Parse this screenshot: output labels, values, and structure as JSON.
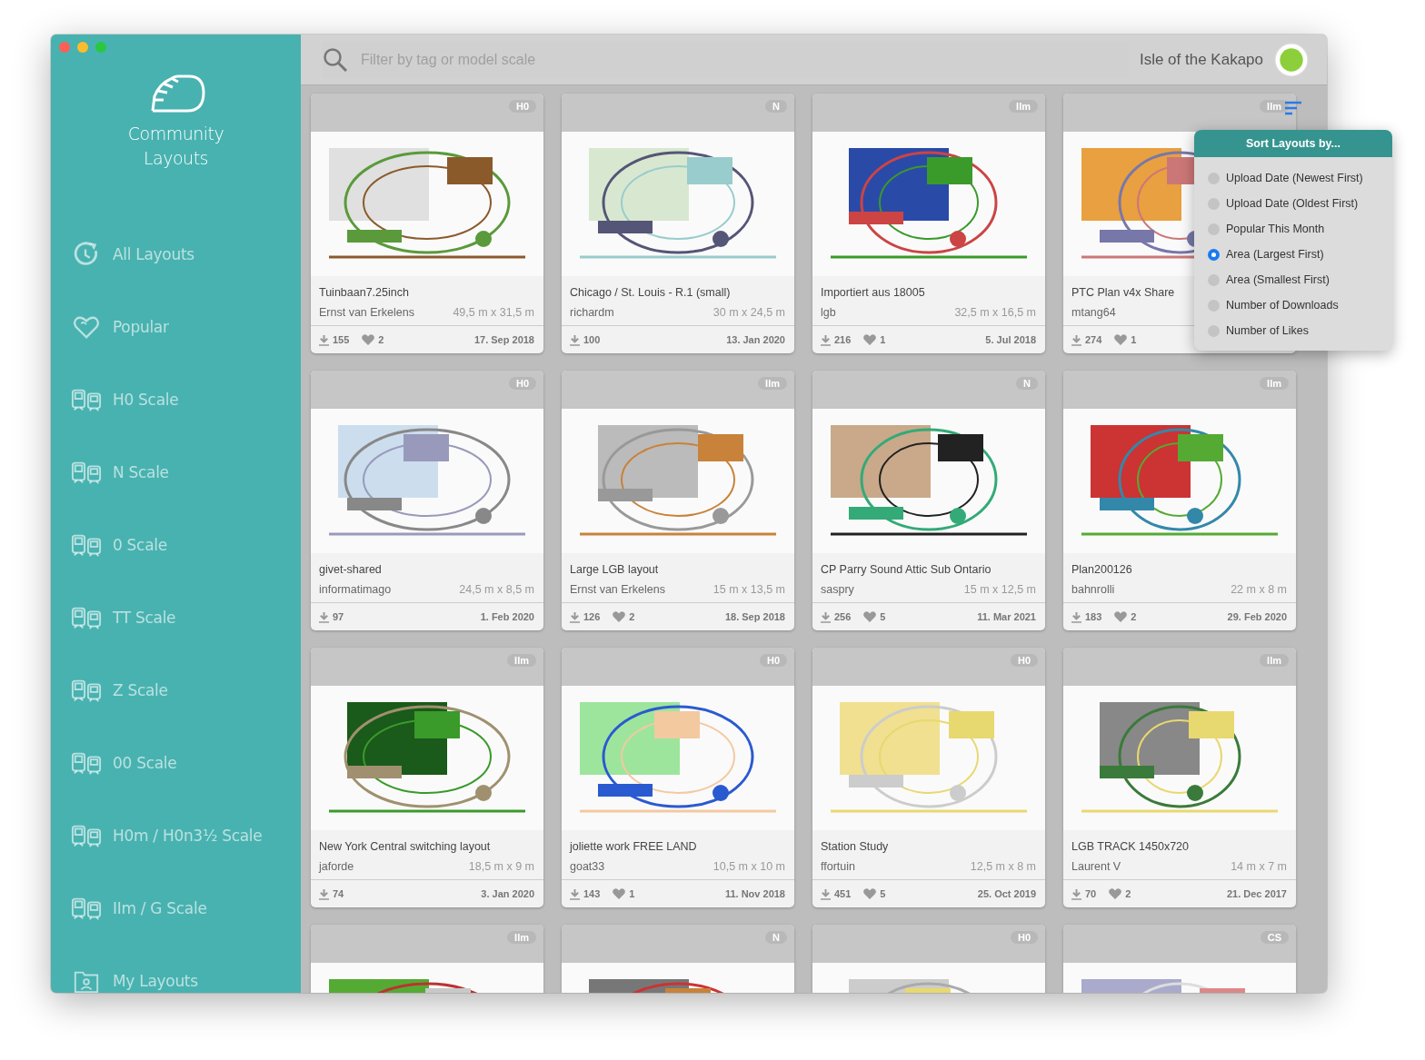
{
  "sidebar": {
    "title": "Community Layouts",
    "items": [
      {
        "label": "All Layouts",
        "kind": "clock"
      },
      {
        "label": "Popular",
        "kind": "heart"
      },
      {
        "label": "H0 Scale",
        "kind": "train"
      },
      {
        "label": "N Scale",
        "kind": "train"
      },
      {
        "label": "0 Scale",
        "kind": "train"
      },
      {
        "label": "TT Scale",
        "kind": "train"
      },
      {
        "label": "Z Scale",
        "kind": "train"
      },
      {
        "label": "00 Scale",
        "kind": "train"
      },
      {
        "label": "H0m / H0n3½ Scale",
        "kind": "train"
      },
      {
        "label": "IIm / G Scale",
        "kind": "train"
      },
      {
        "label": "My Layouts",
        "kind": "folder"
      }
    ]
  },
  "search": {
    "placeholder": "Filter by tag or model scale"
  },
  "user": {
    "name": "Isle of the Kakapo"
  },
  "cards": [
    {
      "scale": "H0",
      "title": "Tuinbaan7.25inch",
      "author": "Ernst van Erkelens",
      "size": "49,5 m x 31,5 m",
      "downloads": "155",
      "likes": "2",
      "date": "17. Sep 2018"
    },
    {
      "scale": "N",
      "title": "Chicago / St. Louis - R.1 (small)",
      "author": "richardm",
      "size": "30 m x 24,5 m",
      "downloads": "100",
      "date": "13. Jan 2020"
    },
    {
      "scale": "IIm",
      "title": "Importiert aus 18005",
      "author": "lgb",
      "size": "32,5 m x 16,5 m",
      "downloads": "216",
      "likes": "1",
      "date": "5. Jul 2018"
    },
    {
      "scale": "IIm",
      "title": "PTC Plan v4x Share",
      "author": "mtang64",
      "downloads": "274",
      "likes": "1"
    },
    {
      "scale": "H0",
      "title": "givet-shared",
      "author": "informatimago",
      "size": "24,5 m x 8,5 m",
      "downloads": "97",
      "date": "1. Feb 2020"
    },
    {
      "scale": "IIm",
      "title": "Large LGB layout",
      "author": "Ernst van Erkelens",
      "size": "15 m x 13,5 m",
      "downloads": "126",
      "likes": "2",
      "date": "18. Sep 2018"
    },
    {
      "scale": "N",
      "title": "CP Parry Sound Attic Sub Ontario",
      "author": "saspry",
      "size": "15 m x 12,5 m",
      "downloads": "256",
      "likes": "5",
      "date": "11. Mar 2021"
    },
    {
      "scale": "IIm",
      "title": "Plan200126",
      "author": "bahnrolli",
      "size": "22 m x 8 m",
      "downloads": "183",
      "likes": "2",
      "date": "29. Feb 2020"
    },
    {
      "scale": "IIm",
      "title": "New York Central switching layout",
      "author": "jaforde",
      "size": "18,5 m x 9 m",
      "downloads": "74",
      "date": "3. Jan 2020"
    },
    {
      "scale": "H0",
      "title": "joliette work FREE LAND",
      "author": "goat33",
      "size": "10,5 m x 10 m",
      "downloads": "143",
      "likes": "1",
      "date": "11. Nov 2018"
    },
    {
      "scale": "H0",
      "title": "Station Study",
      "author": "ffortuin",
      "size": "12,5 m x 8 m",
      "downloads": "451",
      "likes": "5",
      "date": "25. Oct 2019"
    },
    {
      "scale": "IIm",
      "title": "LGB TRACK 1450x720",
      "author": "Laurent V",
      "size": "14 m x 7 m",
      "downloads": "70",
      "likes": "2",
      "date": "21. Dec 2017"
    },
    {
      "scale": "IIm"
    },
    {
      "scale": "N"
    },
    {
      "scale": "H0"
    },
    {
      "scale": "CS"
    }
  ],
  "sort_menu": {
    "title": "Sort Layouts by...",
    "options": [
      {
        "label": "Upload Date (Newest First)",
        "selected": false
      },
      {
        "label": "Upload Date (Oldest First)",
        "selected": false
      },
      {
        "label": "Popular This Month",
        "selected": false
      },
      {
        "label": "Area (Largest First)",
        "selected": true
      },
      {
        "label": "Area (Smallest First)",
        "selected": false
      },
      {
        "label": "Number of Downloads",
        "selected": false
      },
      {
        "label": "Number of Likes",
        "selected": false
      }
    ]
  }
}
